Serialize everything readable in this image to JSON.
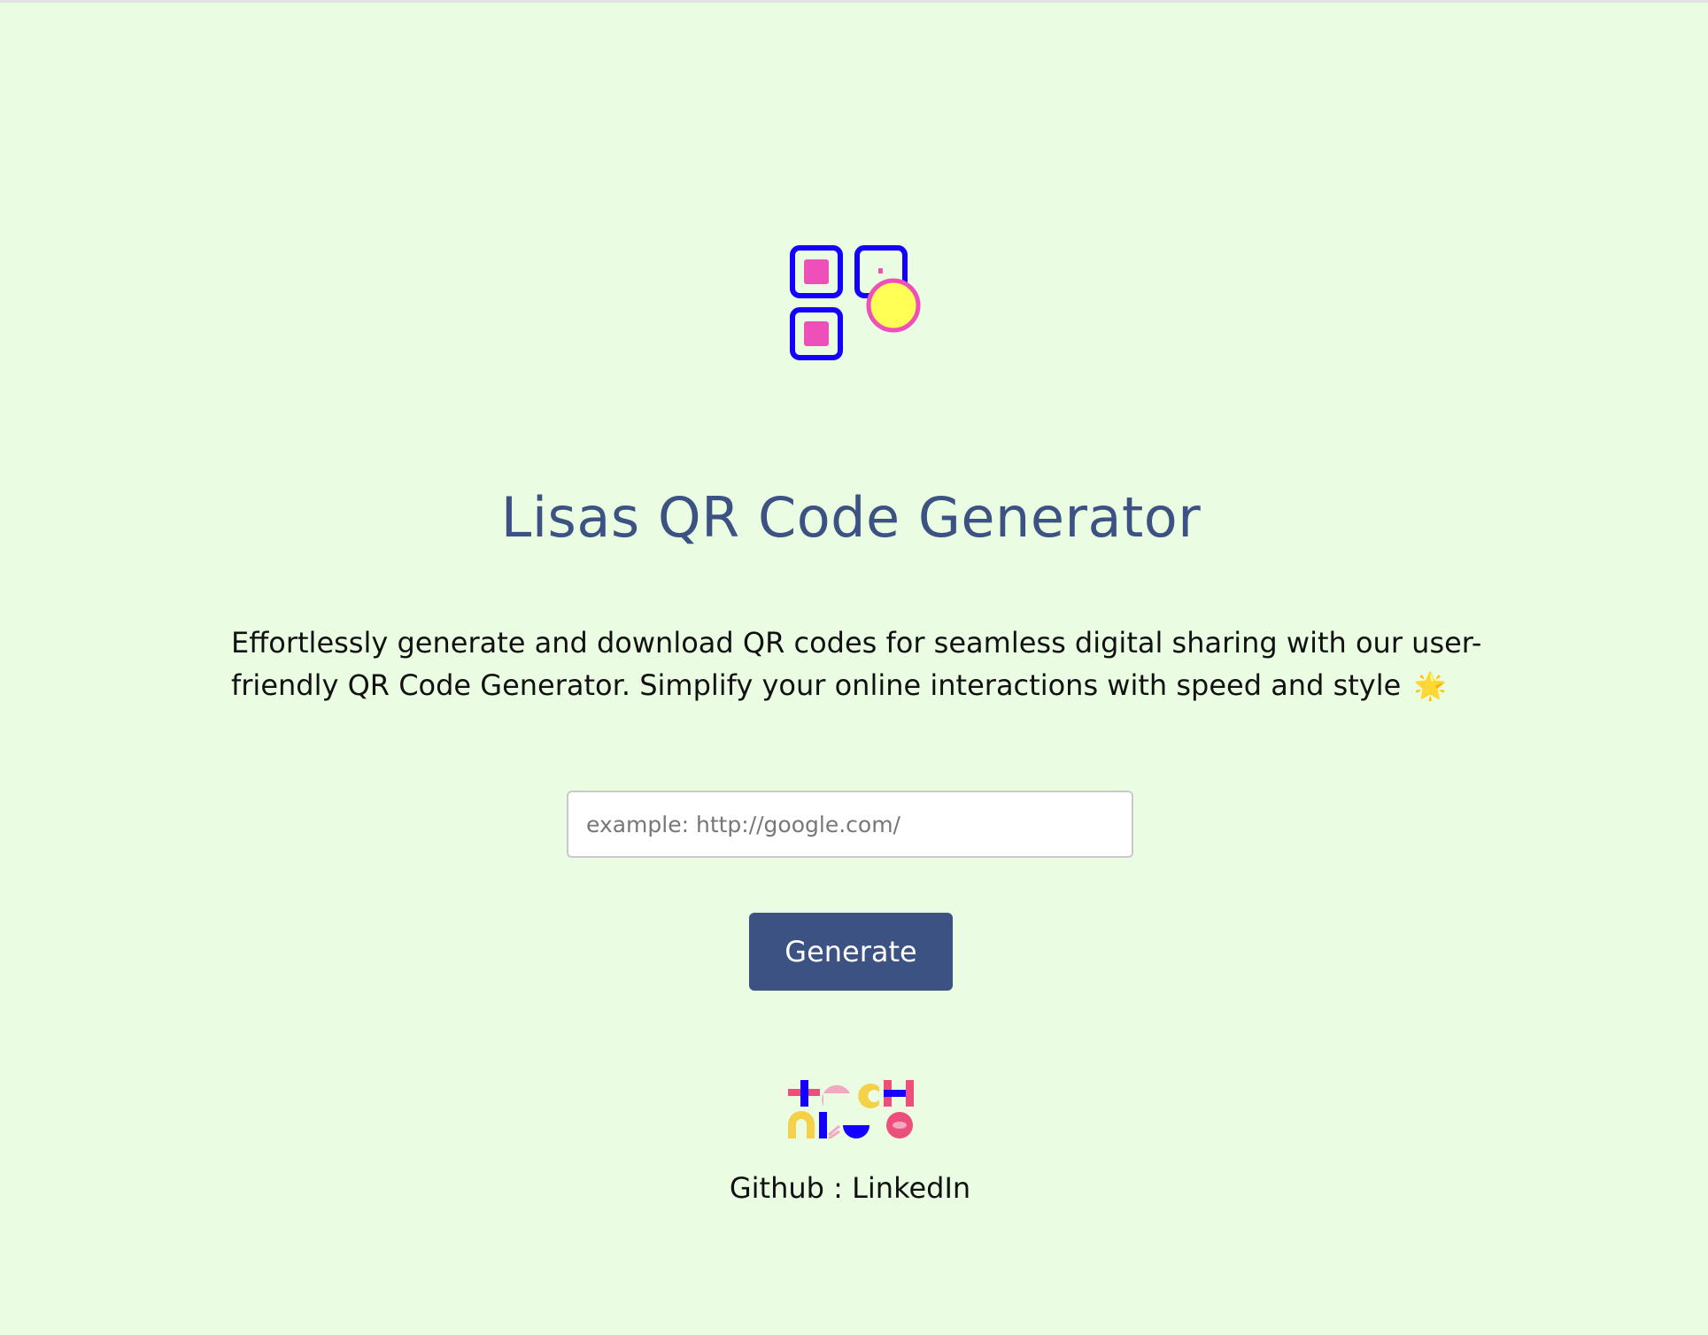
{
  "header": {
    "title": "Lisas QR Code Generator"
  },
  "intro": {
    "description": "Effortlessly generate and download QR codes for seamless digital sharing with our user-friendly QR Code Generator. Simplify your online interactions with speed and style",
    "emoji": "🌟"
  },
  "form": {
    "url_placeholder": "example: http://google.com/",
    "url_value": "",
    "generate_label": "Generate"
  },
  "footer": {
    "brand_logo_text": "techneo",
    "github_label": "Github",
    "separator": " : ",
    "linkedin_label": "LinkedIn"
  },
  "colors": {
    "background": "#eafde3",
    "accent": "#3b5283",
    "logo_blue": "#1400ff",
    "logo_pink": "#ee4fb8",
    "logo_yellow": "#ffff55"
  },
  "icons": {
    "app_logo": "qr-code-icon",
    "sparkle": "sparkle-star-icon"
  }
}
